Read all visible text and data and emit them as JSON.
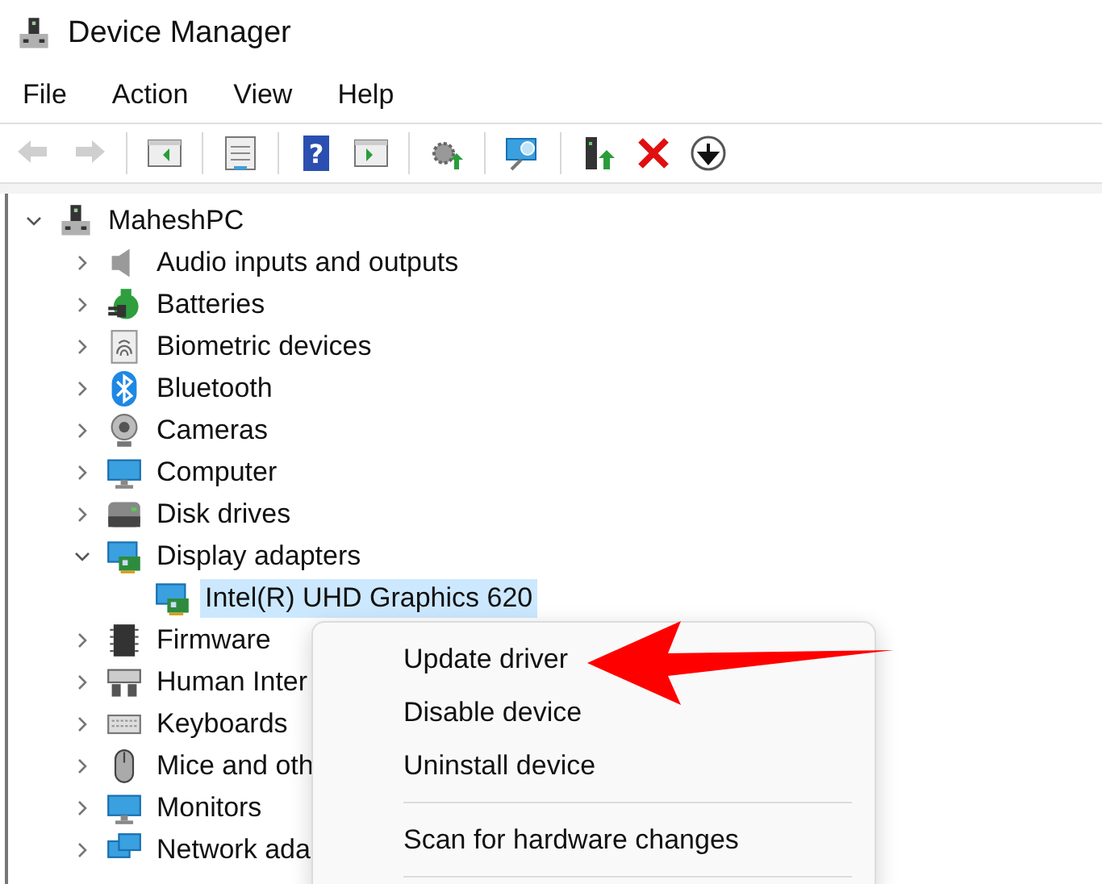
{
  "window": {
    "title": "Device Manager"
  },
  "menu_bar": [
    {
      "label": "File"
    },
    {
      "label": "Action"
    },
    {
      "label": "View"
    },
    {
      "label": "Help"
    }
  ],
  "toolbar": {
    "groups": [
      [
        {
          "disabled": true
        },
        {
          "disabled": true
        }
      ],
      [
        {
          "disabled": false
        }
      ],
      [
        {
          "disabled": false
        }
      ],
      [
        {
          "disabled": false,
          "glyph": "?"
        },
        {
          "disabled": false
        }
      ],
      [
        {
          "disabled": false
        }
      ],
      [
        {
          "disabled": false
        }
      ],
      [
        {
          "disabled": false
        },
        {
          "disabled": false
        },
        {
          "disabled": false
        }
      ]
    ]
  },
  "tree": {
    "items": [
      {
        "label": "MaheshPC",
        "expanded": true,
        "selected": false,
        "children": [
          {
            "label": "Audio inputs and outputs",
            "expanded": false,
            "selected": false
          },
          {
            "label": "Batteries",
            "expanded": false,
            "selected": false
          },
          {
            "label": "Biometric devices",
            "expanded": false,
            "selected": false
          },
          {
            "label": "Bluetooth",
            "expanded": false,
            "selected": false
          },
          {
            "label": "Cameras",
            "expanded": false,
            "selected": false
          },
          {
            "label": "Computer",
            "expanded": false,
            "selected": false
          },
          {
            "label": "Disk drives",
            "expanded": false,
            "selected": false
          },
          {
            "label": "Display adapters",
            "expanded": true,
            "selected": false,
            "children": [
              {
                "label": "Intel(R) UHD Graphics 620",
                "selected": true
              }
            ]
          },
          {
            "label": "Firmware",
            "expanded": false,
            "selected": false
          },
          {
            "label": "Human Inter",
            "expanded": false,
            "selected": false
          },
          {
            "label": "Keyboards",
            "expanded": false,
            "selected": false
          },
          {
            "label": "Mice and oth",
            "expanded": false,
            "selected": false
          },
          {
            "label": "Monitors",
            "expanded": false,
            "selected": false
          },
          {
            "label": "Network ada",
            "expanded": false,
            "selected": false
          }
        ]
      }
    ]
  },
  "context_menu": {
    "items": [
      {
        "kind": "item",
        "label": "Update driver"
      },
      {
        "kind": "item",
        "label": "Disable device"
      },
      {
        "kind": "item",
        "label": "Uninstall device"
      },
      {
        "kind": "separator"
      },
      {
        "kind": "item",
        "label": "Scan for hardware changes"
      },
      {
        "kind": "separator"
      }
    ]
  },
  "annotation": {
    "kind": "arrow"
  }
}
